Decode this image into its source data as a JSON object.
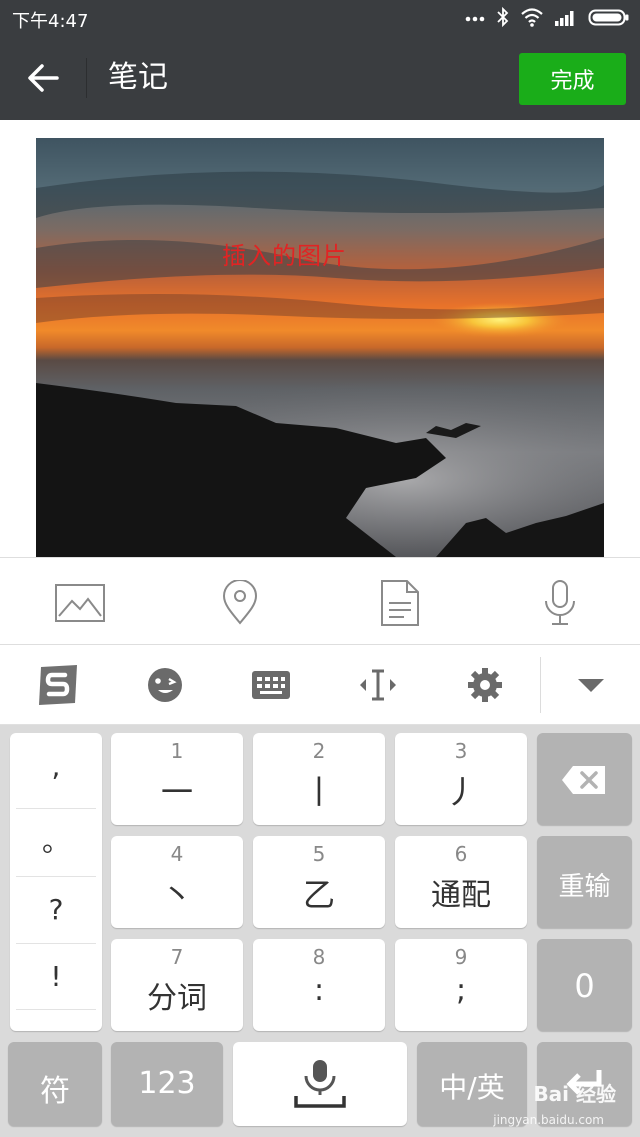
{
  "status_bar": {
    "time": "下午4:47"
  },
  "app_bar": {
    "title": "笔记",
    "done_label": "完成"
  },
  "content": {
    "image_caption": "插入的图片"
  },
  "toolbar": {
    "icons": [
      "image-icon",
      "location-icon",
      "document-icon",
      "microphone-icon"
    ]
  },
  "ime_bar": {
    "icons": [
      "sogou-logo-icon",
      "emoji-icon",
      "keyboard-icon",
      "cursor-move-icon",
      "settings-icon",
      "collapse-keyboard-icon"
    ]
  },
  "keyboard": {
    "punctuation": [
      ",",
      "。",
      "?",
      "!"
    ],
    "keys": [
      {
        "num": "1",
        "label": "一"
      },
      {
        "num": "2",
        "label": "丨"
      },
      {
        "num": "3",
        "label": "丿"
      },
      {
        "num": "4",
        "label": "丶"
      },
      {
        "num": "5",
        "label": "乙"
      },
      {
        "num": "6",
        "label": "通配"
      },
      {
        "num": "7",
        "label": "分词"
      },
      {
        "num": "8",
        "label": ":"
      },
      {
        "num": "9",
        "label": ";"
      }
    ],
    "reenter_label": "重输",
    "zero_label": "0",
    "symbol_label": "符",
    "num123_label": "123",
    "lang_label": "中/英"
  },
  "watermark": {
    "text": "Bai 经验",
    "sub": "jingyan.baidu.com"
  },
  "colors": {
    "bars": "#3a3d40",
    "accent_green": "#1aad19",
    "caption_red": "#e02424",
    "key_gray": "#b3b3b3"
  }
}
